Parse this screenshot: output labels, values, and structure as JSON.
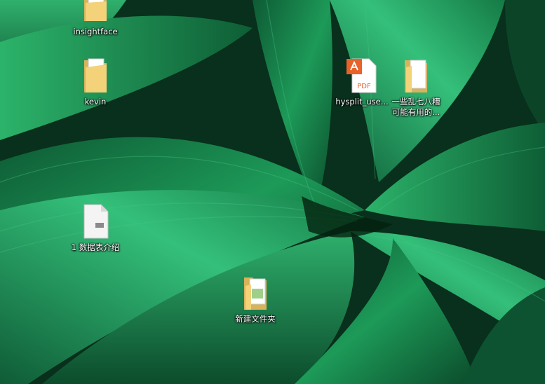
{
  "desktop": {
    "icons": [
      {
        "label": "insightface",
        "icon": "folder-icon"
      },
      {
        "label": "kevin",
        "icon": "folder-icon"
      },
      {
        "label": "1 数据表介绍",
        "icon": "document-icon"
      },
      {
        "label": "新建文件夹",
        "icon": "folder-with-image-icon"
      },
      {
        "label": "hysplit_use...",
        "icon": "pdf-icon"
      },
      {
        "label": "一些乱七八糟\n可能有用的...",
        "icon": "folder-icon"
      }
    ]
  },
  "colors": {
    "wallpaper_dark": "#0a3a22",
    "wallpaper_leaf": "#1e9a5a",
    "wallpaper_light": "#3fc07a",
    "folder": "#f3d27a",
    "pdf_accent": "#e8622a"
  }
}
